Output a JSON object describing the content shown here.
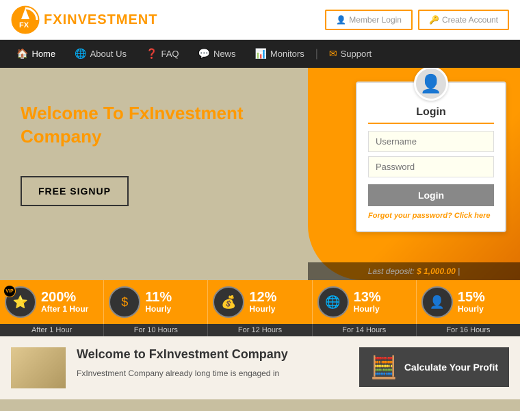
{
  "header": {
    "logo_fx": "FX",
    "logo_investment": "INVESTMENT",
    "member_login_btn": "Member Login",
    "create_account_btn": "Create Account"
  },
  "nav": {
    "items": [
      {
        "label": "Home",
        "icon": "🏠",
        "active": true
      },
      {
        "label": "About Us",
        "icon": "🌐",
        "active": false
      },
      {
        "label": "FAQ",
        "icon": "❓",
        "active": false
      },
      {
        "label": "News",
        "icon": "💬",
        "active": false
      },
      {
        "label": "Monitors",
        "icon": "📊",
        "active": false
      },
      {
        "label": "Support",
        "icon": "✉",
        "active": false
      }
    ]
  },
  "hero": {
    "title": "Welcome To FxInvestment Company",
    "signup_btn": "FREE SIGNUP"
  },
  "login": {
    "title": "Login",
    "username_placeholder": "Username",
    "password_placeholder": "Password",
    "login_btn": "Login",
    "forgot_text": "Forgot your password?",
    "click_text": "Click here"
  },
  "last_deposit": {
    "label": "Last deposit:",
    "amount": "$ 1,000.00",
    "separator": "|"
  },
  "plans": [
    {
      "percent": "200%",
      "label": "After 1 Hour",
      "icon": "⭐",
      "vip": true
    },
    {
      "percent": "11%",
      "label": "Hourly",
      "sublabel": "For 10 Hours",
      "icon": "$"
    },
    {
      "percent": "12%",
      "label": "Hourly",
      "sublabel": "For 12 Hours",
      "icon": "💰"
    },
    {
      "percent": "13%",
      "label": "Hourly",
      "sublabel": "For 14 Hours",
      "icon": "🌐"
    },
    {
      "percent": "15%",
      "label": "Hourly",
      "sublabel": "For 16 Hours",
      "icon": "👤"
    }
  ],
  "bottom": {
    "title": "Welcome to FxInvestment Company",
    "description": "FxInvestment Company already long time is engaged in",
    "calculator_label": "Calculate Your Profit"
  }
}
